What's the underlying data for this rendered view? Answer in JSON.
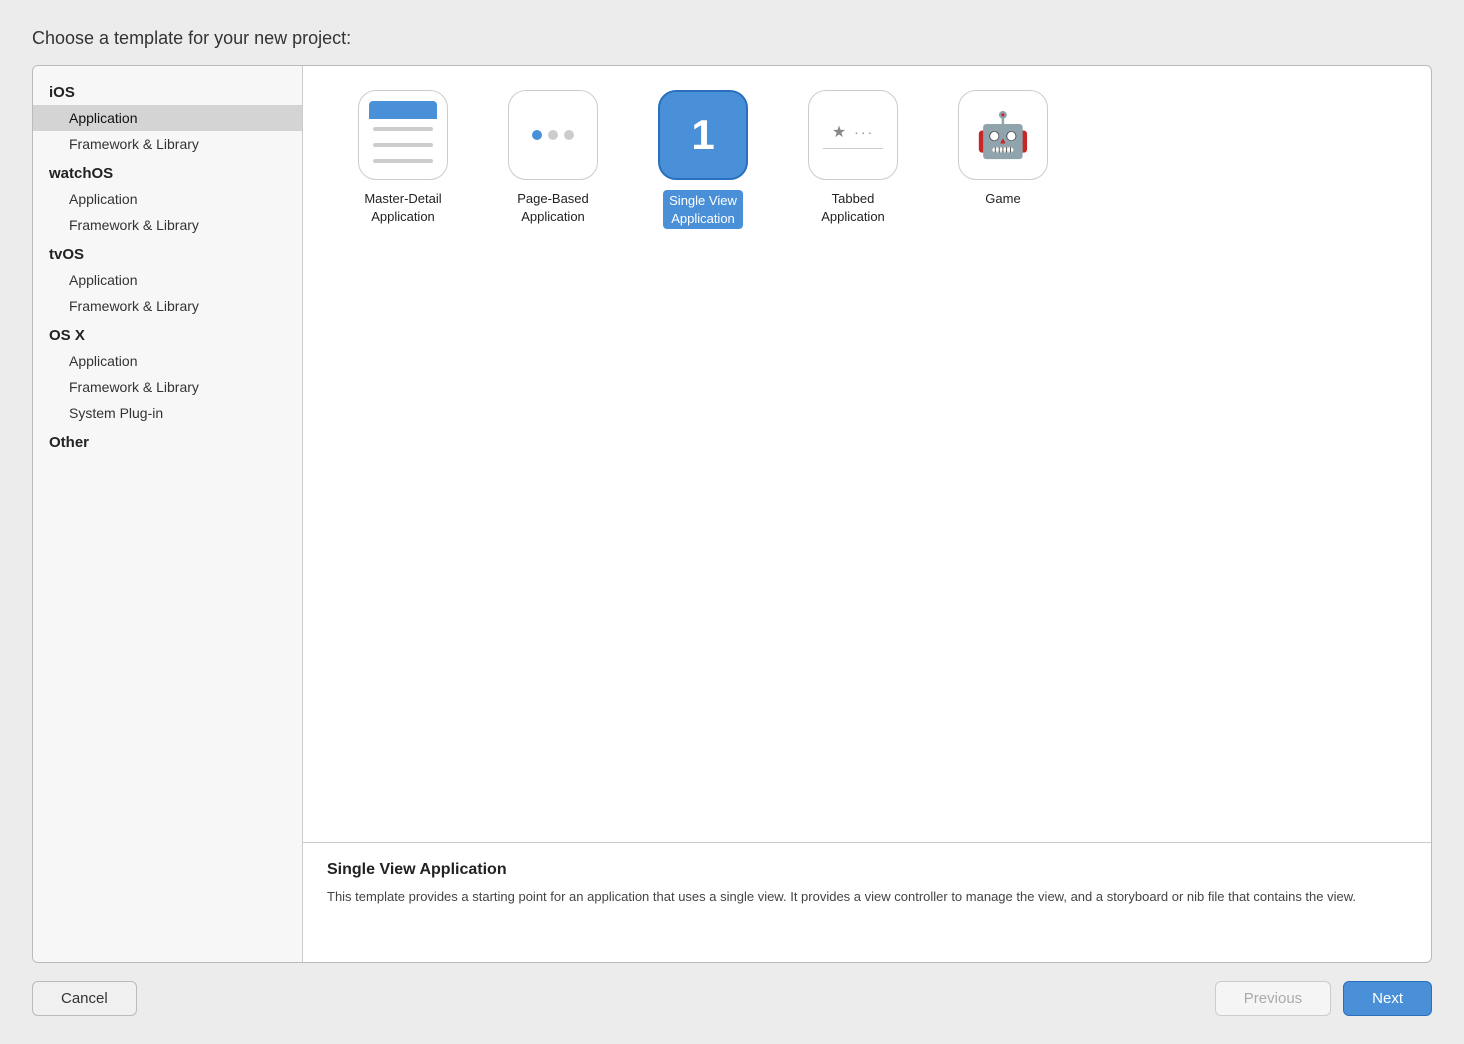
{
  "dialog": {
    "title": "Choose a template for your new project:"
  },
  "sidebar": {
    "groups": [
      {
        "label": "iOS",
        "items": [
          {
            "id": "ios-application",
            "label": "Application",
            "selected": true
          },
          {
            "id": "ios-framework",
            "label": "Framework & Library",
            "selected": false
          }
        ]
      },
      {
        "label": "watchOS",
        "items": [
          {
            "id": "watchos-application",
            "label": "Application",
            "selected": false
          },
          {
            "id": "watchos-framework",
            "label": "Framework & Library",
            "selected": false
          }
        ]
      },
      {
        "label": "tvOS",
        "items": [
          {
            "id": "tvos-application",
            "label": "Application",
            "selected": false
          },
          {
            "id": "tvos-framework",
            "label": "Framework & Library",
            "selected": false
          }
        ]
      },
      {
        "label": "OS X",
        "items": [
          {
            "id": "osx-application",
            "label": "Application",
            "selected": false
          },
          {
            "id": "osx-framework",
            "label": "Framework & Library",
            "selected": false
          },
          {
            "id": "osx-plugin",
            "label": "System Plug-in",
            "selected": false
          }
        ]
      },
      {
        "label": "Other",
        "items": []
      }
    ]
  },
  "templates": [
    {
      "id": "master-detail",
      "label": "Master-Detail\nApplication",
      "selected": false
    },
    {
      "id": "page-based",
      "label": "Page-Based\nApplication",
      "selected": false
    },
    {
      "id": "single-view",
      "label": "Single View\nApplication",
      "selected": true
    },
    {
      "id": "tabbed",
      "label": "Tabbed\nApplication",
      "selected": false
    },
    {
      "id": "game",
      "label": "Game",
      "selected": false
    }
  ],
  "description": {
    "title": "Single View Application",
    "body": "This template provides a starting point for an application that uses a single view. It provides a view controller to manage the view, and a storyboard or nib file that contains the view."
  },
  "buttons": {
    "cancel": "Cancel",
    "previous": "Previous",
    "next": "Next"
  }
}
